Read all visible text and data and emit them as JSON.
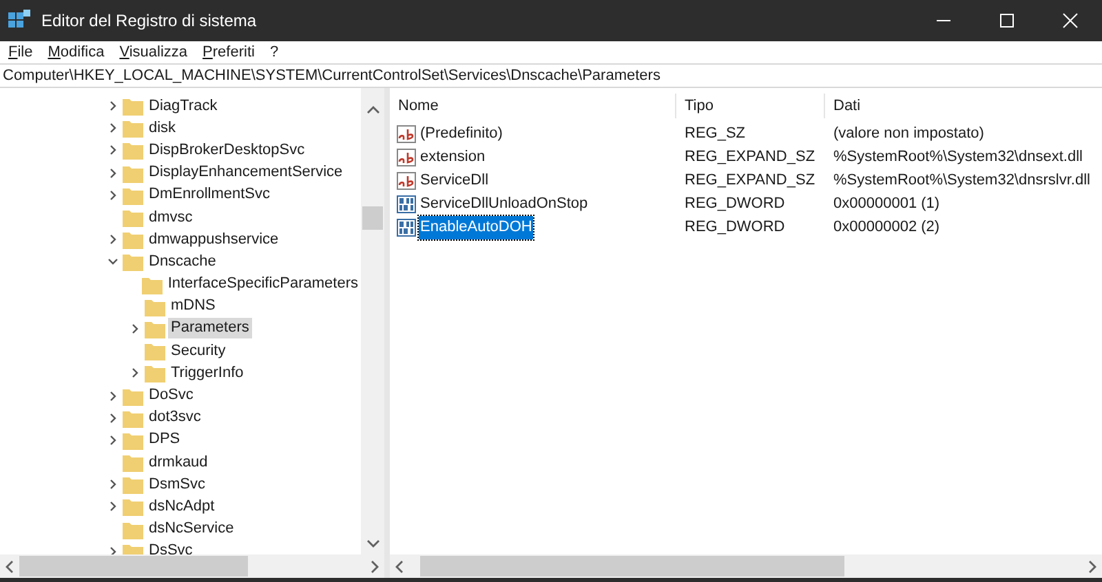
{
  "window": {
    "title": "Editor del Registro di sistema"
  },
  "menu": [
    "File",
    "Modifica",
    "Visualizza",
    "Preferiti",
    "?"
  ],
  "address": "Computer\\HKEY_LOCAL_MACHINE\\SYSTEM\\CurrentControlSet\\Services\\Dnscache\\Parameters",
  "tree": [
    {
      "kind": "node",
      "label": "DiagTrack",
      "expanded": false,
      "selected": false
    },
    {
      "kind": "node",
      "label": "disk",
      "expanded": false,
      "selected": false
    },
    {
      "kind": "node",
      "label": "DispBrokerDesktopSvc",
      "expanded": false,
      "selected": false
    },
    {
      "kind": "node",
      "label": "DisplayEnhancementService",
      "expanded": false,
      "selected": false
    },
    {
      "kind": "node",
      "label": "DmEnrollmentSvc",
      "expanded": false,
      "selected": false
    },
    {
      "kind": "leaf",
      "label": "dmvsc",
      "selected": false
    },
    {
      "kind": "node",
      "label": "dmwappushservice",
      "expanded": false,
      "selected": false
    },
    {
      "kind": "node",
      "label": "Dnscache",
      "expanded": true,
      "selected": false,
      "children": [
        {
          "kind": "leaf",
          "label": "InterfaceSpecificParameters",
          "selected": false
        },
        {
          "kind": "leaf",
          "label": "mDNS",
          "selected": false
        },
        {
          "kind": "node",
          "label": "Parameters",
          "expanded": false,
          "selected": true
        },
        {
          "kind": "leaf",
          "label": "Security",
          "selected": false
        },
        {
          "kind": "node",
          "label": "TriggerInfo",
          "expanded": false,
          "selected": false
        }
      ]
    },
    {
      "kind": "node",
      "label": "DoSvc",
      "expanded": false,
      "selected": false
    },
    {
      "kind": "node",
      "label": "dot3svc",
      "expanded": false,
      "selected": false
    },
    {
      "kind": "node",
      "label": "DPS",
      "expanded": false,
      "selected": false
    },
    {
      "kind": "leaf",
      "label": "drmkaud",
      "selected": false
    },
    {
      "kind": "node",
      "label": "DsmSvc",
      "expanded": false,
      "selected": false
    },
    {
      "kind": "node",
      "label": "dsNcAdpt",
      "expanded": false,
      "selected": false
    },
    {
      "kind": "leaf",
      "label": "dsNcService",
      "selected": false
    },
    {
      "kind": "node",
      "label": "DsSvc",
      "expanded": false,
      "selected": false
    }
  ],
  "table": {
    "columns": [
      "Nome",
      "Tipo",
      "Dati"
    ],
    "rows": [
      {
        "kind": "string",
        "name": "(Predefinito)",
        "type": "REG_SZ",
        "data": "(valore non impostato)",
        "selected": false
      },
      {
        "kind": "string",
        "name": "extension",
        "type": "REG_EXPAND_SZ",
        "data": "%SystemRoot%\\System32\\dnsext.dll",
        "selected": false
      },
      {
        "kind": "string",
        "name": "ServiceDll",
        "type": "REG_EXPAND_SZ",
        "data": "%SystemRoot%\\System32\\dnsrslvr.dll",
        "selected": false
      },
      {
        "kind": "binary",
        "name": "ServiceDllUnloadOnStop",
        "type": "REG_DWORD",
        "data": "0x00000001 (1)",
        "selected": false
      },
      {
        "kind": "binary",
        "name": "EnableAutoDOH",
        "type": "REG_DWORD",
        "data": "0x00000002 (2)",
        "selected": true
      }
    ]
  }
}
